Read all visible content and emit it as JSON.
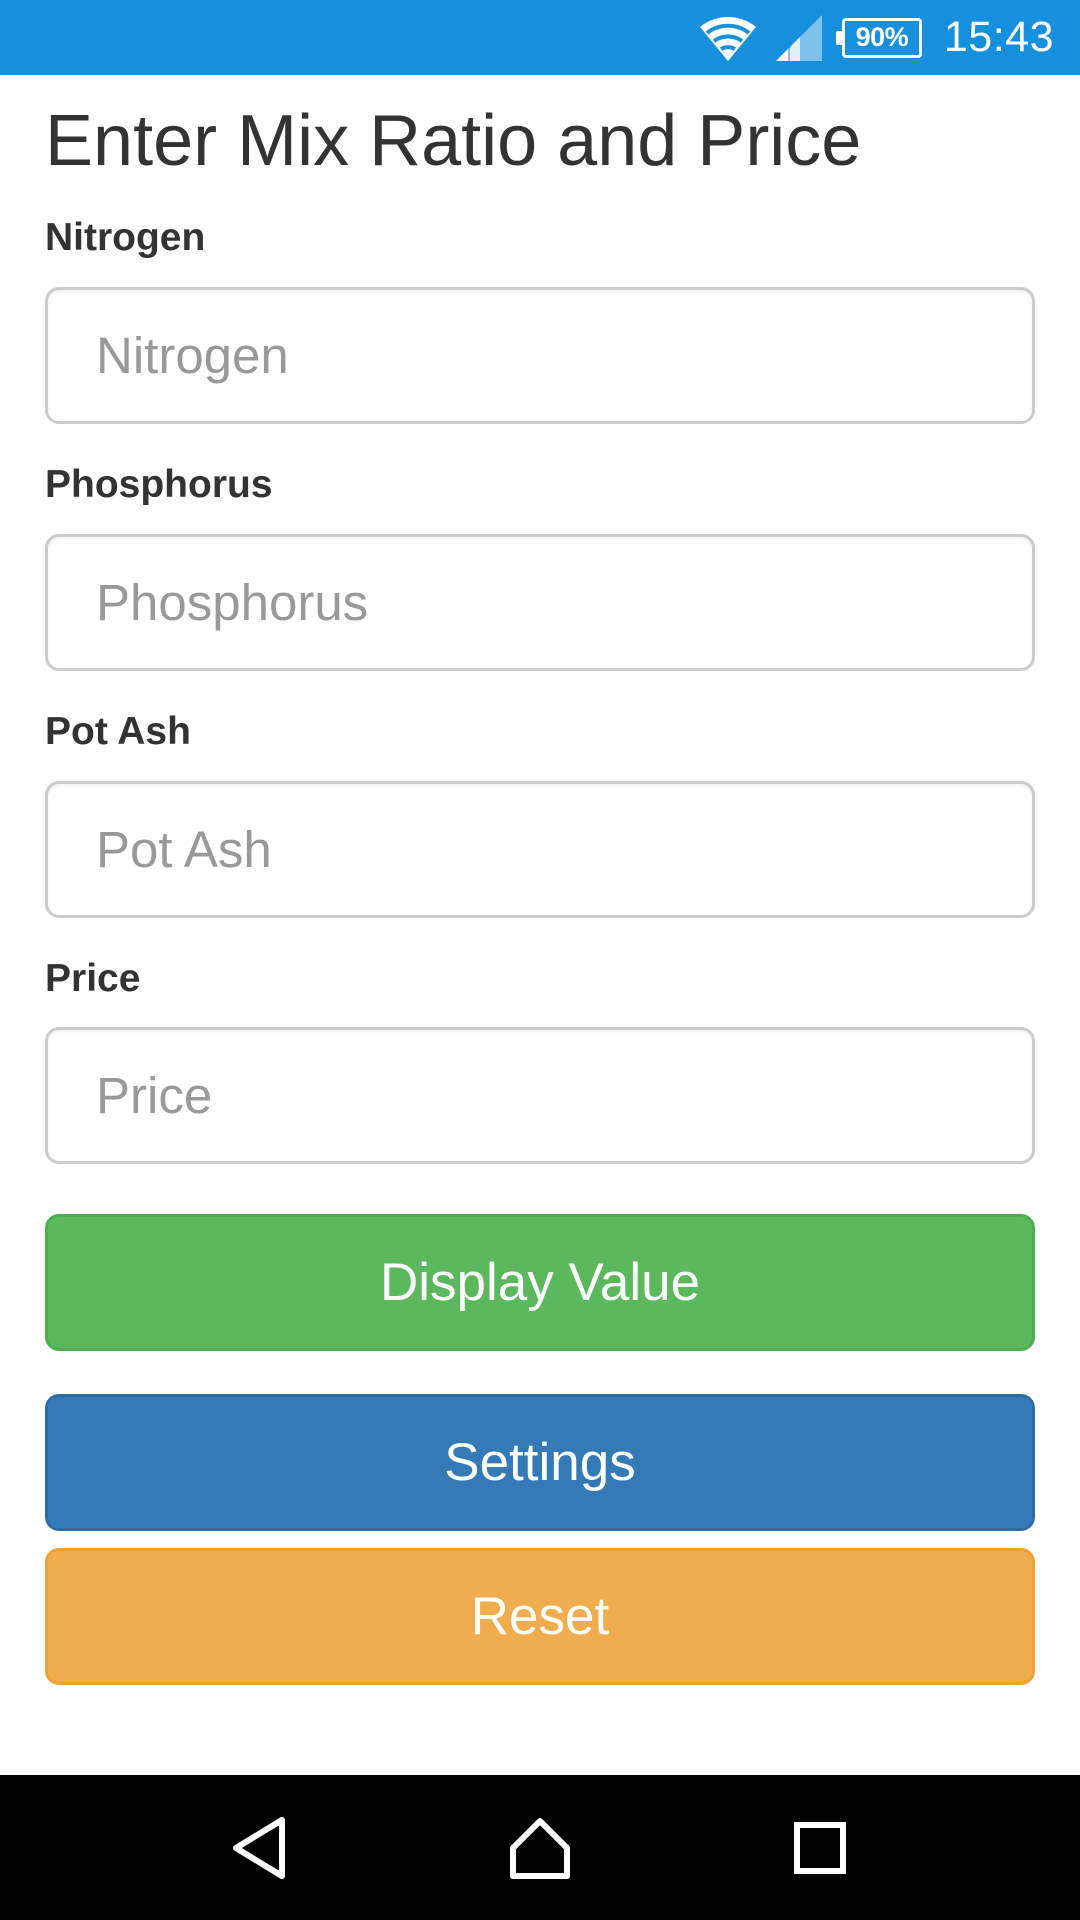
{
  "status_bar": {
    "battery": "90%",
    "time": "15:43",
    "icons": [
      "wifi-icon",
      "cellular-signal-icon",
      "battery-icon"
    ]
  },
  "page": {
    "title": "Enter Mix Ratio and Price"
  },
  "form": {
    "fields": [
      {
        "label": "Nitrogen",
        "placeholder": "Nitrogen",
        "value": ""
      },
      {
        "label": "Phosphorus",
        "placeholder": "Phosphorus",
        "value": ""
      },
      {
        "label": "Pot Ash",
        "placeholder": "Pot Ash",
        "value": ""
      },
      {
        "label": "Price",
        "placeholder": "Price",
        "value": ""
      }
    ]
  },
  "buttons": {
    "display_value": "Display Value",
    "settings": "Settings",
    "reset": "Reset"
  },
  "colors": {
    "status_bar": "#168fdc",
    "display_button": "#5cb85c",
    "settings_button": "#337ab7",
    "reset_button": "#f0ad4e"
  },
  "nav_bar": {
    "icons": [
      "back-icon",
      "home-icon",
      "recents-icon"
    ]
  }
}
